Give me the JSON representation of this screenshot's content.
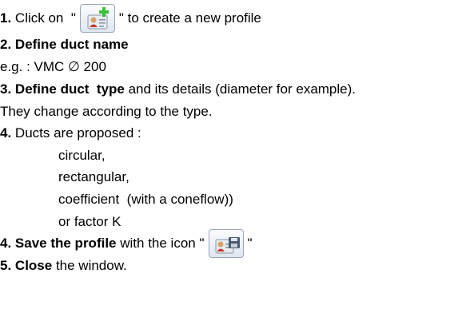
{
  "steps": [
    {
      "num": "1.",
      "before": " Click on  \"",
      "after": "\" to create a new profile",
      "icon": "add-profile-icon"
    },
    {
      "num": "2.",
      "bold": " Define duct name"
    },
    {
      "example": "e.g. : VMC ∅ 200"
    },
    {
      "num": "3.",
      "bold": " Define duct  type",
      "rest": " and its details (diameter for example)."
    },
    {
      "text": "They change according to the type."
    },
    {
      "num": "4.",
      "rest": " Ducts are proposed :"
    },
    {
      "options": [
        "circular,",
        "rectangular,",
        "coefficient  (with a coneflow))",
        "or factor K"
      ]
    },
    {
      "num": "4.",
      "bold": " Save the profile",
      "rest": " with the icon \"",
      "after": "\"",
      "icon": "save-profile-icon"
    },
    {
      "num": "5.",
      "bold": " Close",
      "rest": " the window."
    }
  ]
}
